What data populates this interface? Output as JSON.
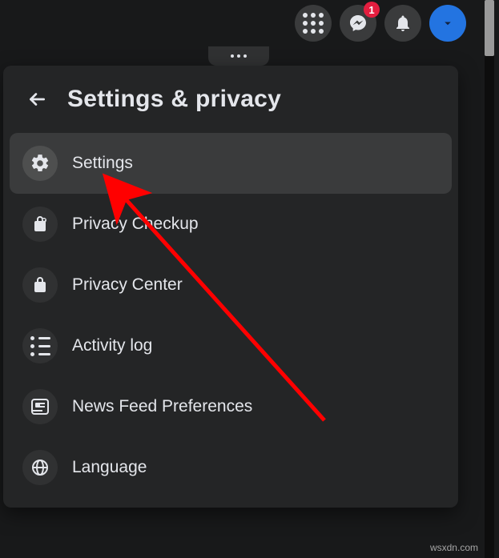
{
  "topnav": {
    "messenger_badge": "1"
  },
  "panel": {
    "title": "Settings & privacy",
    "items": [
      {
        "label": "Settings",
        "icon": "gear",
        "active": true
      },
      {
        "label": "Privacy Checkup",
        "icon": "lock-heart",
        "active": false
      },
      {
        "label": "Privacy Center",
        "icon": "lock",
        "active": false
      },
      {
        "label": "Activity log",
        "icon": "list",
        "active": false
      },
      {
        "label": "News Feed Preferences",
        "icon": "feed",
        "active": false
      },
      {
        "label": "Language",
        "icon": "globe",
        "active": false
      }
    ]
  },
  "watermark": "wsxdn.com"
}
